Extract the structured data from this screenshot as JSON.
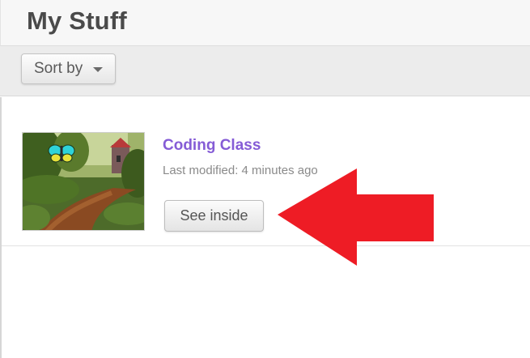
{
  "header": {
    "title": "My Stuff"
  },
  "toolbar": {
    "sort_label": "Sort by",
    "sort_icon": "chevron-down-icon"
  },
  "projects": [
    {
      "title": "Coding Class",
      "last_modified": "Last modified: 4 minutes ago",
      "see_inside_label": "See inside",
      "thumbnail": "forest-path-with-butterfly-thumbnail"
    }
  ],
  "colors": {
    "project_title": "#855cd6",
    "annotation_arrow": "#ee1c25",
    "toolbar_bg": "#ececec"
  }
}
